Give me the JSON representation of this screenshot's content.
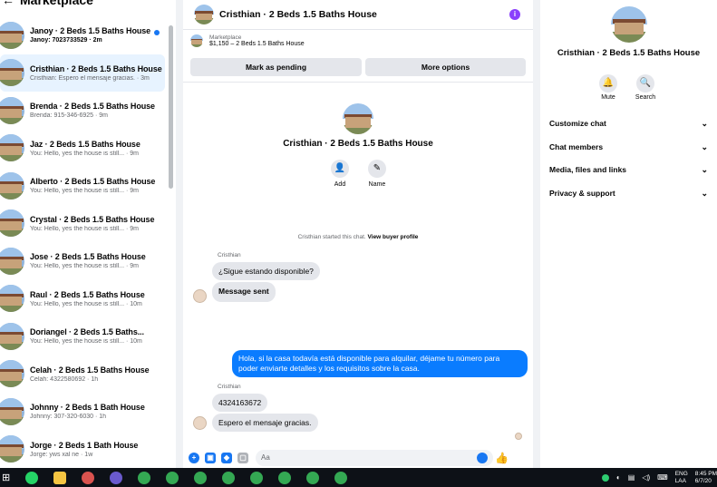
{
  "sidebar": {
    "back_icon": "back-arrow-icon",
    "title": "Marketplace",
    "conversations": [
      {
        "name": "Janoy · 2 Beds 1.5 Baths House",
        "preview": "Janoy: 7023733529 · 2m",
        "unread": true,
        "active": false
      },
      {
        "name": "Cristhian · 2 Beds 1.5 Baths House",
        "preview": "Cristhian: Espero el mensaje gracias. · 3m",
        "unread": false,
        "active": true
      },
      {
        "name": "Brenda · 2 Beds 1.5 Baths House",
        "preview": "Brenda: 915-346-6925 · 9m",
        "unread": false,
        "active": false
      },
      {
        "name": "Jaz · 2 Beds 1.5 Baths House",
        "preview": "You: Hello, yes the house is still...   · 9m",
        "unread": false,
        "active": false
      },
      {
        "name": "Alberto · 2 Beds 1.5 Baths House",
        "preview": "You: Hello, yes the house is still...   · 9m",
        "unread": false,
        "active": false
      },
      {
        "name": "Crystal · 2 Beds 1.5 Baths House",
        "preview": "You: Hello, yes the house is still...   · 9m",
        "unread": false,
        "active": false
      },
      {
        "name": "Jose · 2 Beds 1.5 Baths House",
        "preview": "You: Hello, yes the house is still...   · 9m",
        "unread": false,
        "active": false
      },
      {
        "name": "Raul · 2 Beds 1.5 Baths House",
        "preview": "You: Hello, yes the house is still...   · 10m",
        "unread": false,
        "active": false
      },
      {
        "name": "Doriangel · 2 Beds 1.5 Baths...",
        "preview": "You: Hello, yes the house is still...   · 10m",
        "unread": false,
        "active": false
      },
      {
        "name": "Celah · 2 Beds 1.5 Baths House",
        "preview": "Celah: 4322580692 · 1h",
        "unread": false,
        "active": false
      },
      {
        "name": "Johnny · 2 Beds 1 Bath House",
        "preview": "Johnny: 307-320-6030 · 1h",
        "unread": false,
        "active": false
      },
      {
        "name": "Jorge · 2 Beds 1 Bath House",
        "preview": "Jorge: yws xal ne · 1w",
        "unread": false,
        "active": false
      }
    ]
  },
  "chat": {
    "title": "Cristhian · 2 Beds 1.5 Baths House",
    "info_icon": "info-icon",
    "listing_label": "Marketplace",
    "listing_price": "$1,150 – 2 Beds 1.5 Baths House",
    "mark_pending_label": "Mark as pending",
    "more_options_label": "More options",
    "profile_name": "Cristhian · 2 Beds 1.5 Baths House",
    "add_label": "Add",
    "name_label": "Name",
    "system_message": "Cristhian started this chat.",
    "system_link": "View buyer profile",
    "sender_1": "Cristhian",
    "msg_1": "¿Sigue estando disponible?",
    "msg_2": "Message sent",
    "outgoing": "Hola, si la casa todavía está disponible para alquilar, déjame tu número para poder enviarte detalles y los requisitos sobre la casa.",
    "sender_2": "Cristhian",
    "msg_3": "4324163672",
    "msg_4": "Espero el mensaje gracias.",
    "composer_placeholder": "Aa",
    "composer_icons": [
      "plus-icon",
      "image-icon",
      "sticker-icon",
      "gif-icon"
    ]
  },
  "right_panel": {
    "name": "Cristhian · 2 Beds 1.5 Baths House",
    "mute_label": "Mute",
    "search_label": "Search",
    "sections": [
      "Customize chat",
      "Chat members",
      "Media, files and links",
      "Privacy & support"
    ]
  },
  "taskbar": {
    "lang_1": "ENG",
    "lang_2": "LAA",
    "time": "8:45 PM",
    "date": "6/7/20"
  },
  "colors": {
    "accent": "#1877f2",
    "outgoing_bubble": "#0a7cff",
    "info_purple": "#8a3ffc"
  }
}
